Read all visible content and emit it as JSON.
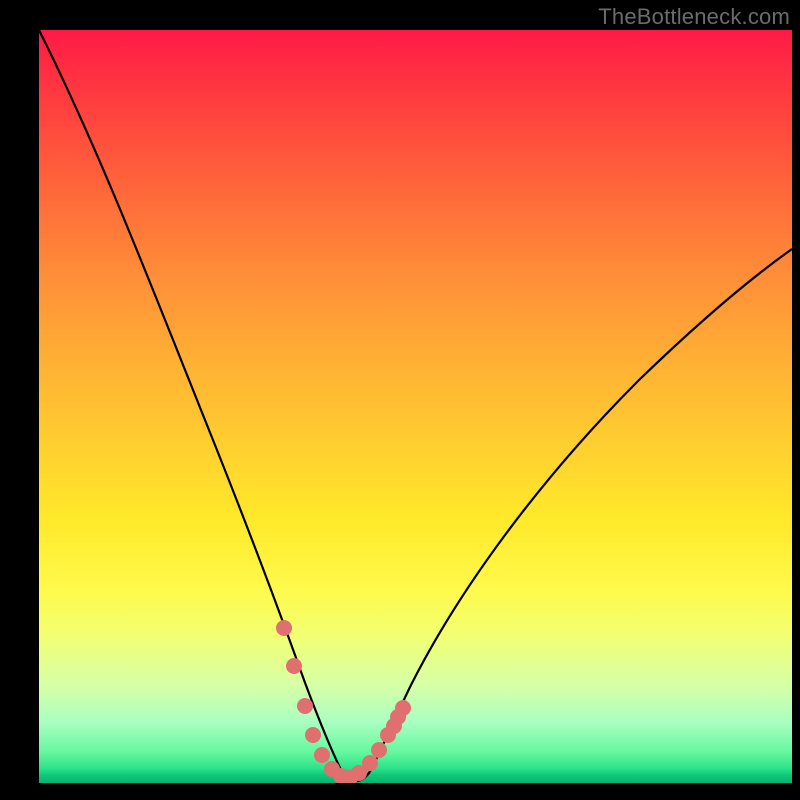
{
  "watermark": {
    "text": "TheBottleneck.com"
  },
  "colors": {
    "background": "#000000",
    "curve_black": "#000000",
    "marker_salmon": "#e07070",
    "gradient_top": "#ff1a46",
    "gradient_bottom": "#08b46e"
  },
  "chart_data": {
    "type": "line",
    "title": "",
    "xlabel": "",
    "ylabel": "",
    "xlim": [
      0,
      100
    ],
    "ylim": [
      0,
      100
    ],
    "grid": false,
    "legend": false,
    "note": "Axes are unlabeled in the image; y maps to bottleneck (%) with 0 at bottom, x spans the displayed range.",
    "series": [
      {
        "name": "bottleneck-curve",
        "x": [
          0,
          4,
          8,
          12,
          16,
          20,
          24,
          28,
          30,
          32,
          34,
          36,
          37.5,
          39,
          40.5,
          42,
          43.5,
          45,
          48,
          52,
          56,
          60,
          66,
          72,
          78,
          84,
          90,
          96,
          100
        ],
        "values": [
          100,
          91.9,
          83.6,
          74.8,
          65.6,
          56.3,
          46.6,
          35.8,
          30.1,
          24.0,
          17.5,
          10.5,
          6.4,
          3.1,
          1.3,
          0.5,
          1.1,
          2.5,
          7.2,
          13.3,
          18.9,
          24.4,
          31.4,
          37.9,
          43.7,
          49.2,
          54.5,
          59.7,
          62.9
        ]
      },
      {
        "name": "highlight-markers",
        "marker_only": true,
        "x": [
          32.6,
          33.9,
          35.3,
          36.4,
          37.6,
          38.9,
          40.1,
          41.3,
          42.5,
          43.9,
          45.2,
          46.4,
          47.1,
          47.7,
          48.3
        ],
        "values": [
          20.6,
          15.6,
          10.2,
          6.4,
          3.7,
          1.9,
          0.9,
          0.7,
          1.3,
          2.6,
          4.4,
          6.4,
          7.6,
          8.8,
          10.0
        ]
      }
    ]
  }
}
